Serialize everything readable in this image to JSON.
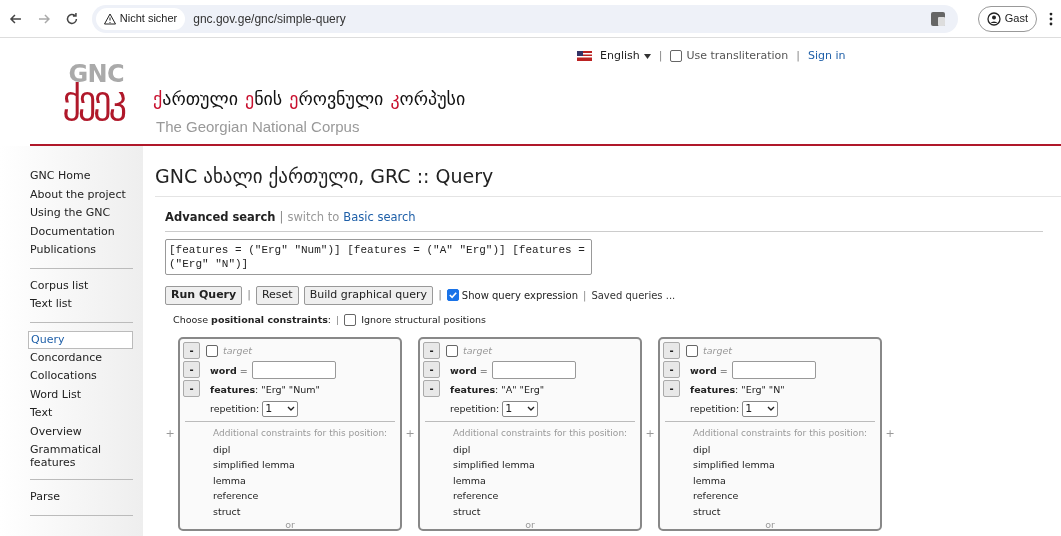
{
  "browser": {
    "security_label": "Nicht sicher",
    "url": "gnc.gov.ge/gnc/simple-query",
    "profile": "Gast"
  },
  "separator": "|",
  "top_links": {
    "language": "English",
    "transliteration": {
      "label": "Use transliteration",
      "checked": false
    },
    "sign_in": "Sign in"
  },
  "logo": {
    "top": "GNC",
    "bottom": "ქეეკ"
  },
  "site_title": {
    "words": [
      "ქართული",
      "ენის",
      "ეროვნული",
      "კორპუსი"
    ],
    "subtitle": "The Georgian National Corpus"
  },
  "sidebar": {
    "groups": [
      {
        "items": [
          {
            "label": "GNC Home",
            "selected": false
          },
          {
            "label": "About the project",
            "selected": false
          },
          {
            "label": "Using the GNC",
            "selected": false
          },
          {
            "label": "Documentation",
            "selected": false
          },
          {
            "label": "Publications",
            "selected": false
          }
        ]
      },
      {
        "items": [
          {
            "label": "Corpus list",
            "selected": false
          },
          {
            "label": "Text list",
            "selected": false
          }
        ]
      },
      {
        "items": [
          {
            "label": "Query",
            "selected": true
          },
          {
            "label": "Concordance",
            "selected": false
          },
          {
            "label": "Collocations",
            "selected": false
          },
          {
            "label": "Word List",
            "selected": false
          },
          {
            "label": "Text",
            "selected": false
          },
          {
            "label": "Overview",
            "selected": false
          },
          {
            "label": "Grammatical features",
            "selected": false
          }
        ]
      },
      {
        "items": [
          {
            "label": "Parse",
            "selected": false
          }
        ]
      }
    ]
  },
  "page_title": "GNC ახალი ქართული, GRC :: Query",
  "search_mode": {
    "current": "Advanced search",
    "switch_prefix": "switch to",
    "switch_link": "Basic search"
  },
  "query_expression": "[features = (\"Erg\" \"Num\")] [features = (\"A\" \"Erg\")] [features = (\"Erg\" \"N\")]",
  "buttons": [
    "Run Query",
    "Reset",
    "Build graphical query"
  ],
  "show_query_expression": {
    "label": "Show query expression",
    "checked": true
  },
  "saved_queries": "Saved queries ...",
  "positional": {
    "label": "Choose **positional constraints**:",
    "ignore": {
      "label": "Ignore structural positions",
      "checked": false
    }
  },
  "positions": [
    {
      "remove_buttons": [
        "-",
        "-",
        "-"
      ],
      "target": {
        "label": "target",
        "checked": false
      },
      "word_label": "**word** =",
      "features": "**features**: \"Erg\" \"Num\"",
      "repetition_label": "repetition:",
      "repetition": "1",
      "additional_heading": "Additional constraints for this position:",
      "additional": [
        "dipl",
        "simplified lemma",
        "lemma",
        "reference",
        "struct"
      ],
      "or": "or"
    },
    {
      "remove_buttons": [
        "-",
        "-",
        "-"
      ],
      "target": {
        "label": "target",
        "checked": false
      },
      "word_label": "**word** =",
      "features": "**features**: \"A\" \"Erg\"",
      "repetition_label": "repetition:",
      "repetition": "1",
      "additional_heading": "Additional constraints for this position:",
      "additional": [
        "dipl",
        "simplified lemma",
        "lemma",
        "reference",
        "struct"
      ],
      "or": "or"
    },
    {
      "remove_buttons": [
        "-",
        "-",
        "-"
      ],
      "target": {
        "label": "target",
        "checked": false
      },
      "word_label": "**word** =",
      "features": "**features**: \"Erg\" \"N\"",
      "repetition_label": "repetition:",
      "repetition": "1",
      "additional_heading": "Additional constraints for this position:",
      "additional": [
        "dipl",
        "simplified lemma",
        "lemma",
        "reference",
        "struct"
      ],
      "or": "or"
    }
  ],
  "add_marker": "+"
}
